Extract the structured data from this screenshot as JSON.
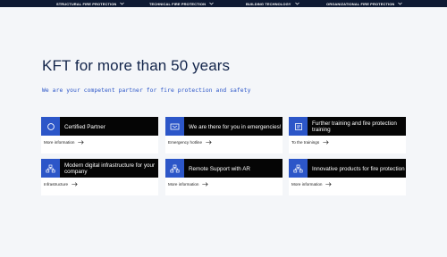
{
  "nav": {
    "items": [
      {
        "label": "STRUCTURAL FIRE PROTECTION"
      },
      {
        "label": "TECHNICAL FIRE PROTECTION"
      },
      {
        "label": "BUILDING TECHNOLOGY"
      },
      {
        "label": "ORGANIZATIONAL FIRE PROTECTION"
      }
    ]
  },
  "main": {
    "heading": "KFT for more than 50 years",
    "subtitle": "We are your competent partner for fire protection and safety"
  },
  "cards": [
    {
      "title": "Certified Partner",
      "link": "More information",
      "icon": "certificate-icon"
    },
    {
      "title": "We are there for you in emergencies!",
      "link": "Emergency hotline",
      "icon": "emergency-icon"
    },
    {
      "title": "Further training and fire protection training",
      "link": "To the trainings",
      "icon": "training-icon"
    },
    {
      "title": "Modern digital infrastructure for your company",
      "link": "Infrastructure",
      "icon": "network-icon"
    },
    {
      "title": "Remote Support with AR",
      "link": "More information",
      "icon": "remote-support-icon"
    },
    {
      "title": "Innovative products for fire protection",
      "link": "More information",
      "icon": "products-icon"
    }
  ],
  "colors": {
    "nav_background": "#0e1a33",
    "accent_blue": "#2c56c8",
    "card_bar": "#050505",
    "page_background": "#f4f6f9"
  }
}
